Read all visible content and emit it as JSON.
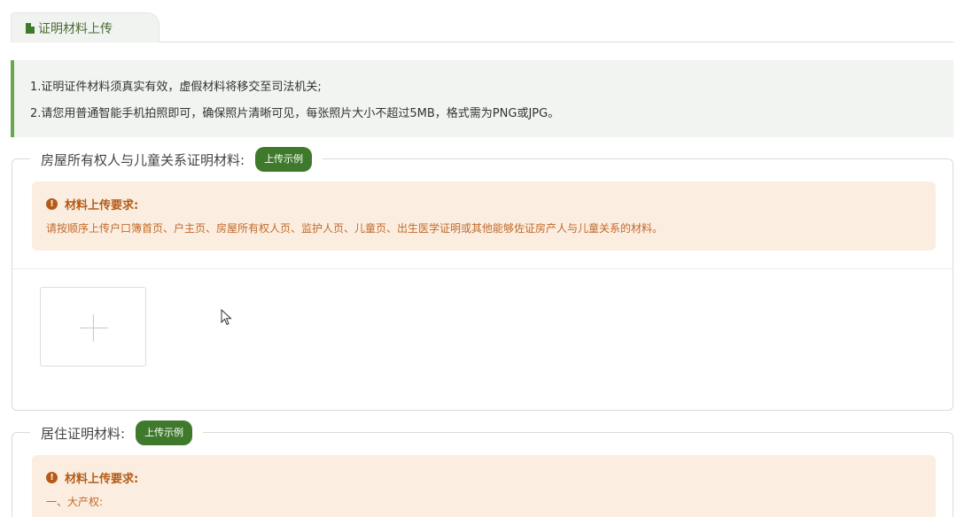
{
  "tab": {
    "label": "证明材料上传",
    "icon": "document-icon"
  },
  "notice": {
    "lines": [
      "1.证明证件材料须真实有效，虚假材料将移交至司法机关;",
      "2.请您用普通智能手机拍照即可，确保照片清晰可见，每张照片大小不超过5MB，格式需为PNG或JPG。"
    ]
  },
  "sections": [
    {
      "label": "房屋所有权人与儿童关系证明材料:",
      "sample_button": "上传示例",
      "requirement_title": "材料上传要求:",
      "requirement_text": "请按顺序上传户口簿首页、户主页、房屋所有权人页、监护人页、儿童页、出生医学证明或其他能够佐证房产人与儿童关系的材料。"
    },
    {
      "label": "居住证明材料:",
      "sample_button": "上传示例",
      "requirement_title": "材料上传要求:",
      "requirement_text": "一、大产权:"
    }
  ],
  "colors": {
    "accent": "#3f7a2c",
    "notice_border": "#6aa84f",
    "requirement_bg": "#fbeee0",
    "requirement_text": "#c2692a"
  }
}
